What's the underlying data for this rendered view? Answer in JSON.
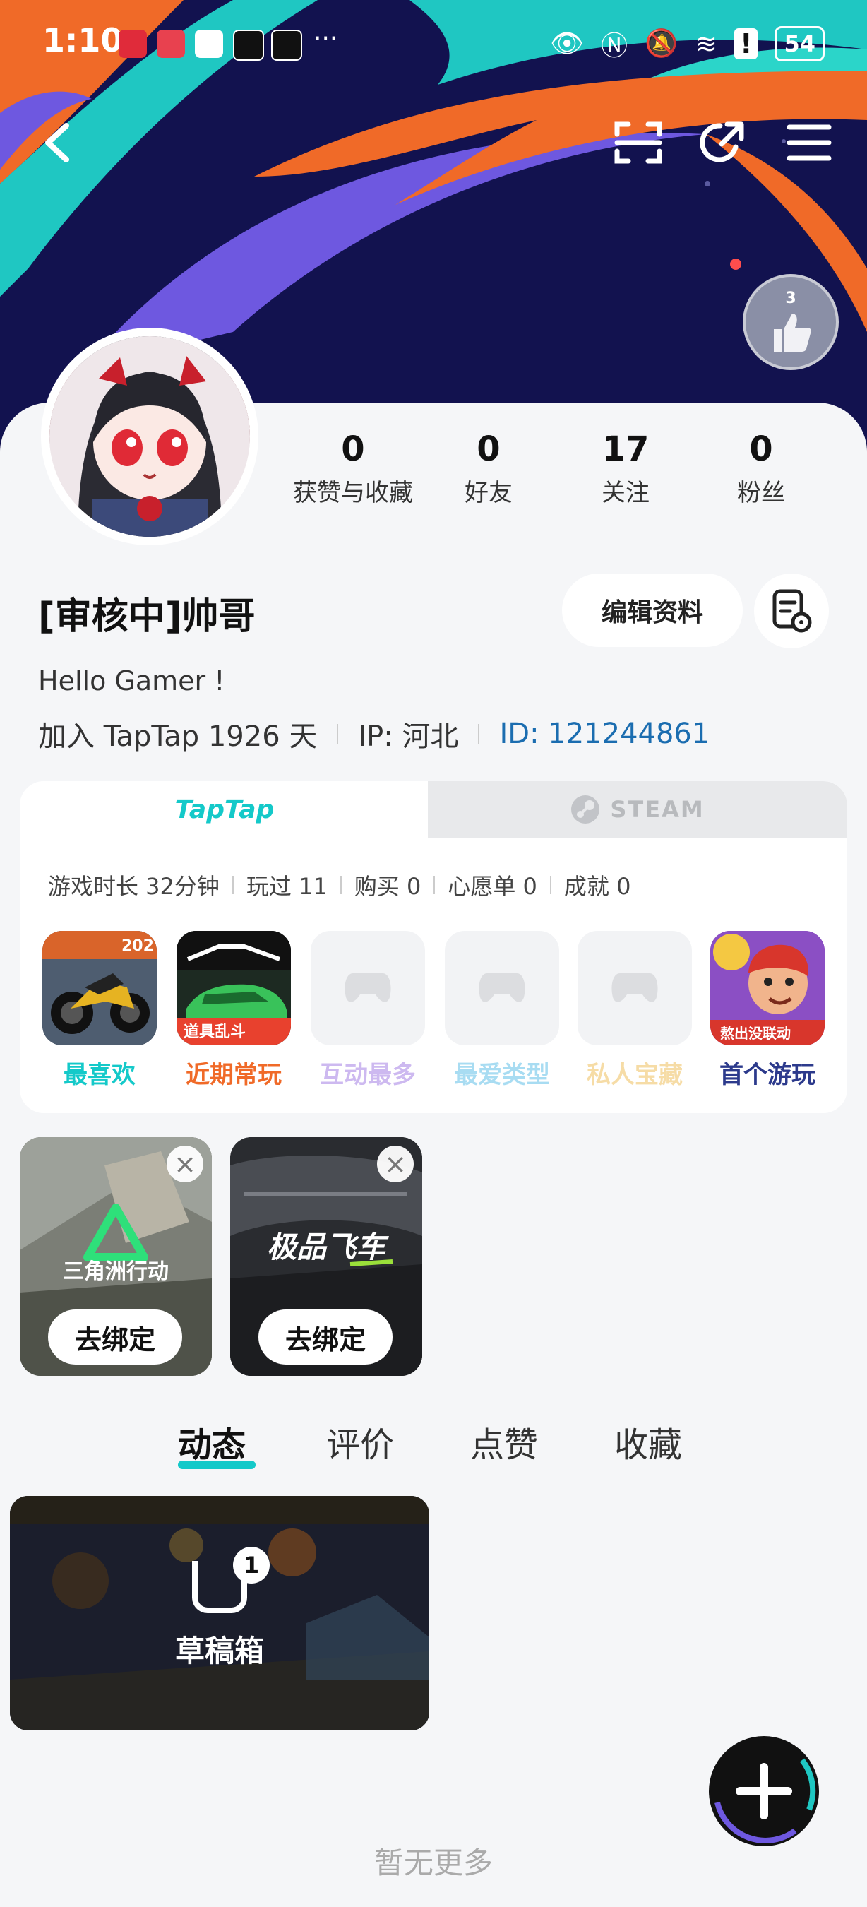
{
  "status_bar": {
    "time": "1:10",
    "battery": "54"
  },
  "header": {
    "badge_count": "3"
  },
  "stats": [
    {
      "value": "0",
      "label": "获赞与收藏"
    },
    {
      "value": "0",
      "label": "好友"
    },
    {
      "value": "17",
      "label": "关注"
    },
    {
      "value": "0",
      "label": "粉丝"
    }
  ],
  "profile": {
    "nickname": "[审核中]帅哥",
    "edit_label": "编辑资料",
    "bio": "Hello Gamer !",
    "join_text": "加入 TapTap 1926 天",
    "ip_text": "IP: 河北",
    "id_text": "ID: 121244861"
  },
  "platform_tabs": {
    "taptap": "TapTap",
    "steam": "STEAM"
  },
  "game_stats": [
    "游戏时长 32分钟",
    "玩过 11",
    "购买 0",
    "心愿单 0",
    "成就 0"
  ],
  "game_tiles": [
    {
      "label": "最喜欢",
      "color": "#14c9c9"
    },
    {
      "label": "近期常玩",
      "color": "#f06a28"
    },
    {
      "label": "互动最多",
      "color": "#cdb9f0"
    },
    {
      "label": "最爱类型",
      "color": "#a8dcf2"
    },
    {
      "label": "私人宝藏",
      "color": "#f6dca6"
    },
    {
      "label": "首个游玩",
      "color": "#2c3a8c"
    }
  ],
  "game_tile_texts": {
    "moto_year": "202",
    "racing_caption": "道具乱斗",
    "subway_caption": "熬出没联动"
  },
  "bound_games": [
    {
      "title": "三角洲行动",
      "unbind_label": "去绑定"
    },
    {
      "title": "极品飞车",
      "unbind_label": "去绑定"
    }
  ],
  "feed_tabs": [
    "动态",
    "评价",
    "点赞",
    "收藏"
  ],
  "drafts": {
    "label": "草稿箱",
    "count": "1"
  },
  "footer": {
    "no_more": "暂无更多"
  },
  "colors": {
    "accent": "#14c9c9",
    "id_blue": "#1b6db0"
  }
}
